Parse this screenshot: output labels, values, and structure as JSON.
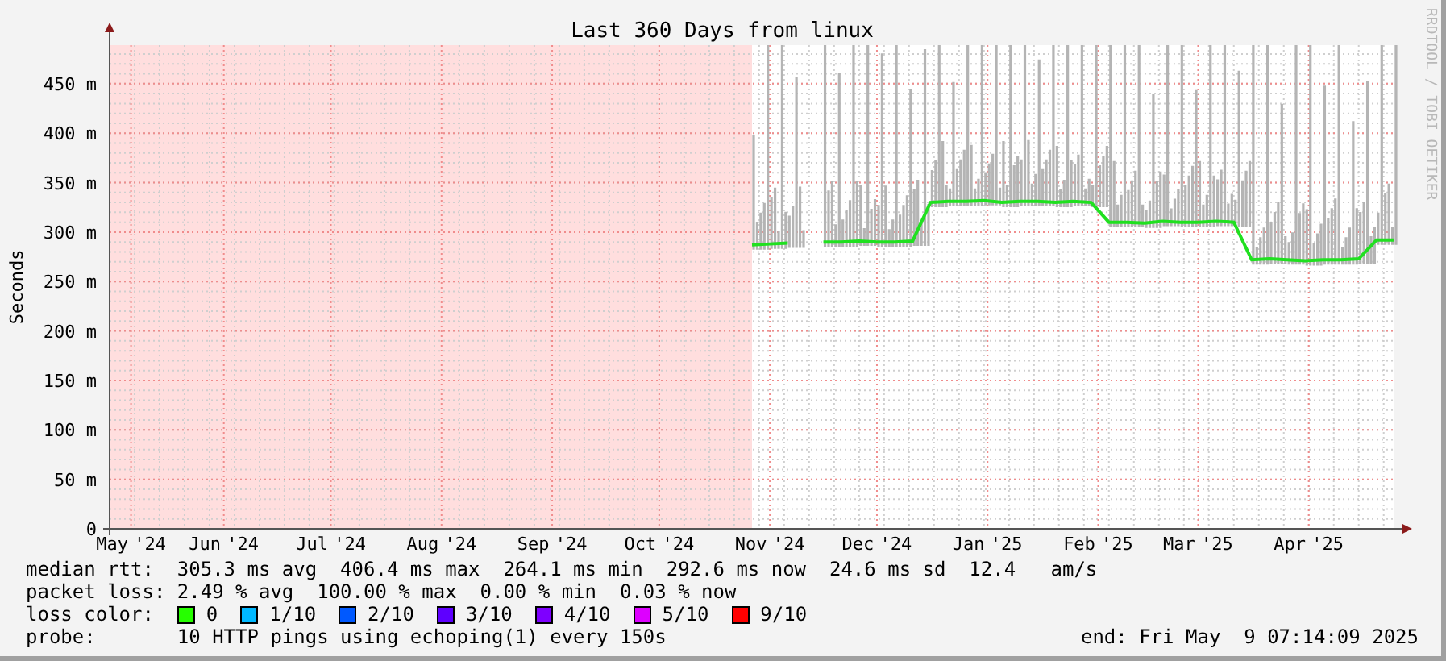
{
  "chart_data": {
    "type": "line",
    "title": "Last 360 Days from linux",
    "ylabel": "Seconds",
    "grid": true,
    "xlim": [
      "2024-05-14",
      "2025-05-09"
    ],
    "ylim": [
      0,
      489
    ],
    "xticks": [
      {
        "value": "2024-05-20",
        "label": "May '24"
      },
      {
        "value": "2024-06-15",
        "label": "Jun '24"
      },
      {
        "value": "2024-07-15",
        "label": "Jul '24"
      },
      {
        "value": "2024-08-15",
        "label": "Aug '24"
      },
      {
        "value": "2024-09-15",
        "label": "Sep '24"
      },
      {
        "value": "2024-10-15",
        "label": "Oct '24"
      },
      {
        "value": "2024-11-15",
        "label": "Nov '24"
      },
      {
        "value": "2024-12-15",
        "label": "Dec '24"
      },
      {
        "value": "2025-01-15",
        "label": "Jan '25"
      },
      {
        "value": "2025-02-15",
        "label": "Feb '25"
      },
      {
        "value": "2025-03-15",
        "label": "Mar '25"
      },
      {
        "value": "2025-04-15",
        "label": "Apr '25"
      }
    ],
    "yticks": [
      {
        "value": 0,
        "label": "0"
      },
      {
        "value": 50,
        "label": "50 m"
      },
      {
        "value": 100,
        "label": "100 m"
      },
      {
        "value": 150,
        "label": "150 m"
      },
      {
        "value": 200,
        "label": "200 m"
      },
      {
        "value": 250,
        "label": "250 m"
      },
      {
        "value": 300,
        "label": "300 m"
      },
      {
        "value": 350,
        "label": "350 m"
      },
      {
        "value": 400,
        "label": "400 m"
      },
      {
        "value": 450,
        "label": "450 m"
      }
    ],
    "x": [
      "2024-11-10",
      "2024-11-15",
      "2024-11-20",
      "2024-11-25",
      "2024-11-30",
      "2024-12-05",
      "2024-12-10",
      "2024-12-15",
      "2024-12-20",
      "2024-12-25",
      "2024-12-30",
      "2025-01-04",
      "2025-01-09",
      "2025-01-14",
      "2025-01-19",
      "2025-01-24",
      "2025-01-29",
      "2025-02-03",
      "2025-02-08",
      "2025-02-13",
      "2025-02-18",
      "2025-02-23",
      "2025-02-28",
      "2025-03-05",
      "2025-03-10",
      "2025-03-15",
      "2025-03-20",
      "2025-03-25",
      "2025-03-30",
      "2025-04-04",
      "2025-04-09",
      "2025-04-14",
      "2025-04-19",
      "2025-04-24",
      "2025-04-29",
      "2025-05-04",
      "2025-05-09"
    ],
    "series": [
      {
        "name": "median rtt:",
        "color": "#20e020",
        "values": [
          287,
          288,
          289,
          null,
          290,
          290,
          291,
          290,
          290,
          291,
          330,
          331,
          331,
          332,
          330,
          331,
          331,
          330,
          331,
          330,
          310,
          310,
          309,
          311,
          310,
          310,
          311,
          310,
          272,
          273,
          272,
          271,
          272,
          272,
          273,
          292,
          292
        ]
      }
    ]
  },
  "credit": "RRDTOOL / TOBI OETIKER",
  "stats": [
    {
      "text": "305.3 ms avg  406.4 ms max  264.1 ms min  292.6 ms now  24.6 ms sd  12.4   am/s"
    },
    {
      "label": "packet loss:",
      "text": "2.49 % avg  100.00 % max  0.00 % min  0.03 % now"
    }
  ],
  "loss_color": {
    "label": "loss color:",
    "items": [
      {
        "label": "0",
        "color": "#26ff00"
      },
      {
        "label": "1/10",
        "color": "#00b8ff"
      },
      {
        "label": "2/10",
        "color": "#0059ff"
      },
      {
        "label": "3/10",
        "color": "#5e00ff"
      },
      {
        "label": "4/10",
        "color": "#7e00ff"
      },
      {
        "label": "5/10",
        "color": "#dd00ff"
      },
      {
        "label": "9/10",
        "color": "#ff0000"
      }
    ]
  },
  "probe": {
    "label": "probe:",
    "text": "10 HTTP pings using echoping(1) every 150s"
  },
  "end": "end: Fri May  9 07:14:09 2025"
}
